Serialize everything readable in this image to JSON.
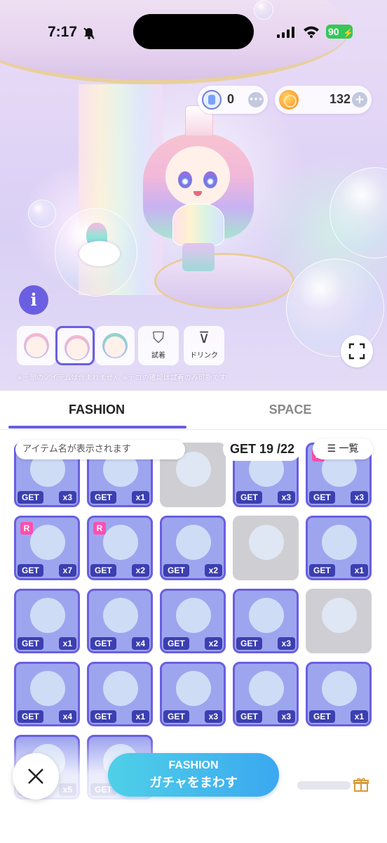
{
  "status_bar": {
    "time": "7:17",
    "battery": "90"
  },
  "currency": {
    "tickets": "0",
    "coins": "132"
  },
  "preview": {
    "tools": [
      {
        "label": "試着",
        "icon": "shirt-icon"
      },
      {
        "label": "ドリンク",
        "icon": "drink-icon"
      }
    ],
    "notice": "※一部のアイテムは含まれません ※デコの確認は試着のみ可能です"
  },
  "tabs": {
    "fashion": "FASHION",
    "space": "SPACE"
  },
  "collection": {
    "name_placeholder": "アイテム名が表示されます",
    "get_count": "GET 19 /22",
    "list_label": "☰ 一覧",
    "get_label": "GET",
    "items": [
      {
        "owned": true,
        "count": "x3",
        "rare": false
      },
      {
        "owned": true,
        "count": "x1",
        "rare": false
      },
      {
        "owned": false,
        "count": "",
        "rare": false
      },
      {
        "owned": true,
        "count": "x3",
        "rare": false
      },
      {
        "owned": true,
        "count": "x3",
        "rare": true
      },
      {
        "owned": true,
        "count": "x7",
        "rare": true
      },
      {
        "owned": true,
        "count": "x2",
        "rare": true
      },
      {
        "owned": true,
        "count": "x2",
        "rare": false
      },
      {
        "owned": false,
        "count": "",
        "rare": false
      },
      {
        "owned": true,
        "count": "x1",
        "rare": false
      },
      {
        "owned": true,
        "count": "x1",
        "rare": false
      },
      {
        "owned": true,
        "count": "x4",
        "rare": false
      },
      {
        "owned": true,
        "count": "x2",
        "rare": false
      },
      {
        "owned": true,
        "count": "x3",
        "rare": false
      },
      {
        "owned": false,
        "count": "",
        "rare": false
      },
      {
        "owned": true,
        "count": "x4",
        "rare": false
      },
      {
        "owned": true,
        "count": "x1",
        "rare": false
      },
      {
        "owned": true,
        "count": "x3",
        "rare": false
      },
      {
        "owned": true,
        "count": "x3",
        "rare": false
      },
      {
        "owned": true,
        "count": "x1",
        "rare": false
      },
      {
        "owned": true,
        "count": "x5",
        "rare": false
      },
      {
        "owned": true,
        "count": "",
        "rare": false
      }
    ],
    "rarity_label": "R"
  },
  "gacha": {
    "line1": "FASHION",
    "line2": "ガチャをまわす"
  },
  "colors": {
    "accent": "#6a5fe0",
    "tag": "#3b3fb0",
    "gacha_start": "#4fd0e8",
    "gacha_end": "#3ba8f0",
    "rarity": "#ff4fb0"
  }
}
